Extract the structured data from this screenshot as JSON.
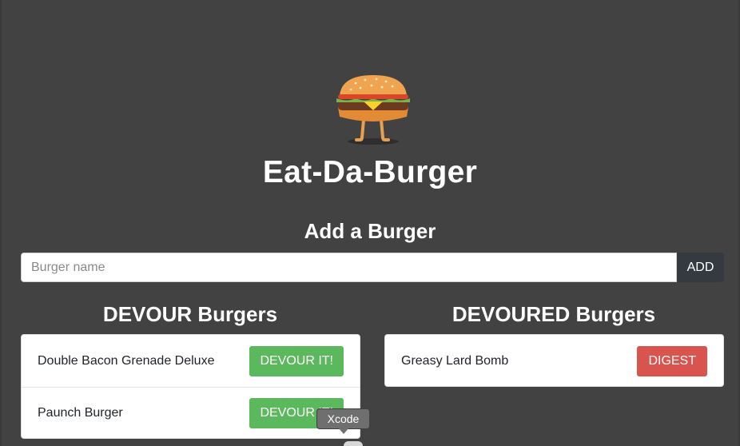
{
  "app": {
    "title": "Eat-Da-Burger",
    "logo_icon": "burger-mascot-icon"
  },
  "add_form": {
    "heading": "Add a Burger",
    "input_value": "",
    "input_placeholder": "Burger name",
    "button_label": "ADD"
  },
  "devour_column": {
    "heading": "DEVOUR Burgers",
    "items": [
      {
        "name": "Double Bacon Grenade Deluxe",
        "button_label": "DEVOUR IT!"
      },
      {
        "name": "Paunch Burger",
        "button_label": "DEVOUR IT!"
      }
    ]
  },
  "devoured_column": {
    "heading": "DEVOURED Burgers",
    "items": [
      {
        "name": "Greasy Lard Bomb",
        "button_label": "DIGEST"
      }
    ]
  },
  "tooltip": {
    "text": "Xcode"
  },
  "colors": {
    "background": "#424242",
    "devour_button": "#5cb85c",
    "digest_button": "#d9534f",
    "add_button": "#353a40"
  }
}
